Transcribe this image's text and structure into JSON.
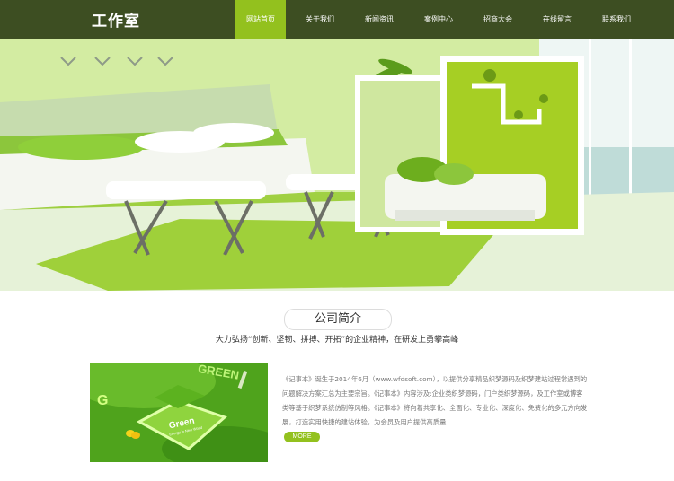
{
  "header": {
    "logo": "工作室",
    "nav": [
      {
        "label": "网站首页",
        "active": true
      },
      {
        "label": "关于我们",
        "active": false
      },
      {
        "label": "新闻资讯",
        "active": false
      },
      {
        "label": "案例中心",
        "active": false
      },
      {
        "label": "招商大会",
        "active": false
      },
      {
        "label": "在线留言",
        "active": false
      },
      {
        "label": "联系我们",
        "active": false
      }
    ]
  },
  "banner": {
    "slides": 3,
    "active_slide": 3
  },
  "about": {
    "title": "公司简介",
    "slogan": "大力弘扬“创新、坚韧、拼搏、开拓”的企业精神，在研发上勇攀高峰",
    "text": "《记事本》诞生于2014年6月（www.wfdsoft.com），以提供分享精品织梦源码及织梦建站过程常遇到的问题解决方案汇总为主要宗旨。《记事本》内容涉及:企业类织梦源码，门户类织梦源码，及工作室或博客类等基于织梦系统仿制等风格。《记事本》将向着共享化、全面化、专业化、深度化、免费化的多元方向发展，打造实用快捷的建站体验，为会员及用户提供高质量...",
    "more_label": "MORE",
    "image_words": [
      "GREEN",
      "G",
      "Green",
      "Energy in New World"
    ]
  },
  "colors": {
    "header_bg": "#3d4e22",
    "accent": "#93c11e",
    "active_dot": "#f0a33a"
  }
}
